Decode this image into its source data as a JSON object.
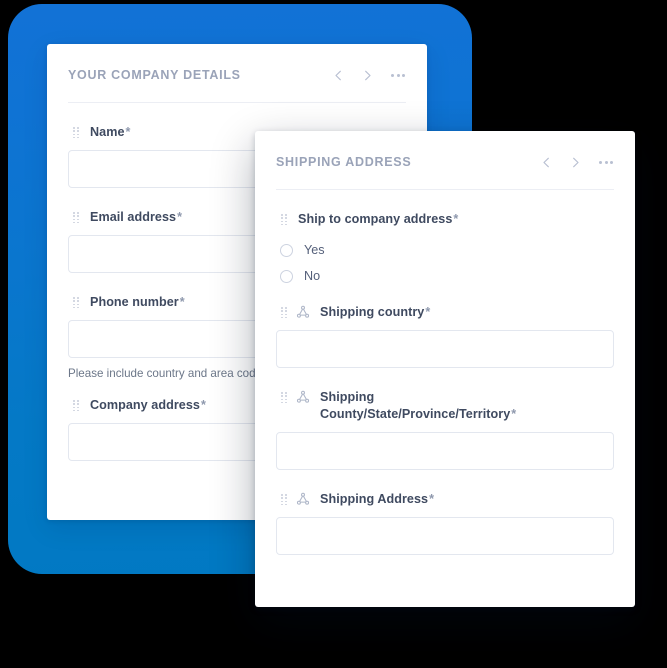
{
  "theme": {
    "backdrop_blue_top": "#1272d6",
    "backdrop_blue_bottom": "#0179c3",
    "page_background": "#000000",
    "card_background": "#ffffff",
    "label_color": "#3f4a60",
    "title_color": "#9aa3b8",
    "input_border": "#e3e7ef"
  },
  "cards": {
    "company_details": {
      "title": "YOUR COMPANY DETAILS",
      "nav": {
        "prev_icon": "chevron-left-icon",
        "next_icon": "chevron-right-icon",
        "more_icon": "ellipsis-icon"
      },
      "fields": [
        {
          "label": "Name",
          "required_marker": "*",
          "value": "",
          "placeholder": "",
          "helper": ""
        },
        {
          "label": "Email address",
          "required_marker": "*",
          "value": "",
          "placeholder": "",
          "helper": ""
        },
        {
          "label": "Phone number",
          "required_marker": "*",
          "value": "",
          "placeholder": "",
          "helper": "Please include country and area code"
        },
        {
          "label": "Company address",
          "required_marker": "*",
          "value": "",
          "placeholder": "",
          "helper": ""
        }
      ]
    },
    "shipping_address": {
      "title": "SHIPPING ADDRESS",
      "nav": {
        "prev_icon": "chevron-left-icon",
        "next_icon": "chevron-right-icon",
        "more_icon": "ellipsis-icon"
      },
      "radio_field": {
        "label": "Ship to company address",
        "required_marker": "*",
        "options": [
          {
            "label": "Yes",
            "selected": false
          },
          {
            "label": "No",
            "selected": false
          }
        ]
      },
      "fields": [
        {
          "label": "Shipping country",
          "required_marker": "*",
          "icon": "hierarchy-node-icon",
          "value": "",
          "placeholder": ""
        },
        {
          "label": "Shipping County/State/Province/Territory",
          "required_marker": "*",
          "icon": "hierarchy-node-icon",
          "value": "",
          "placeholder": ""
        },
        {
          "label": "Shipping Address",
          "required_marker": "*",
          "icon": "hierarchy-node-icon",
          "value": "",
          "placeholder": ""
        }
      ]
    }
  }
}
